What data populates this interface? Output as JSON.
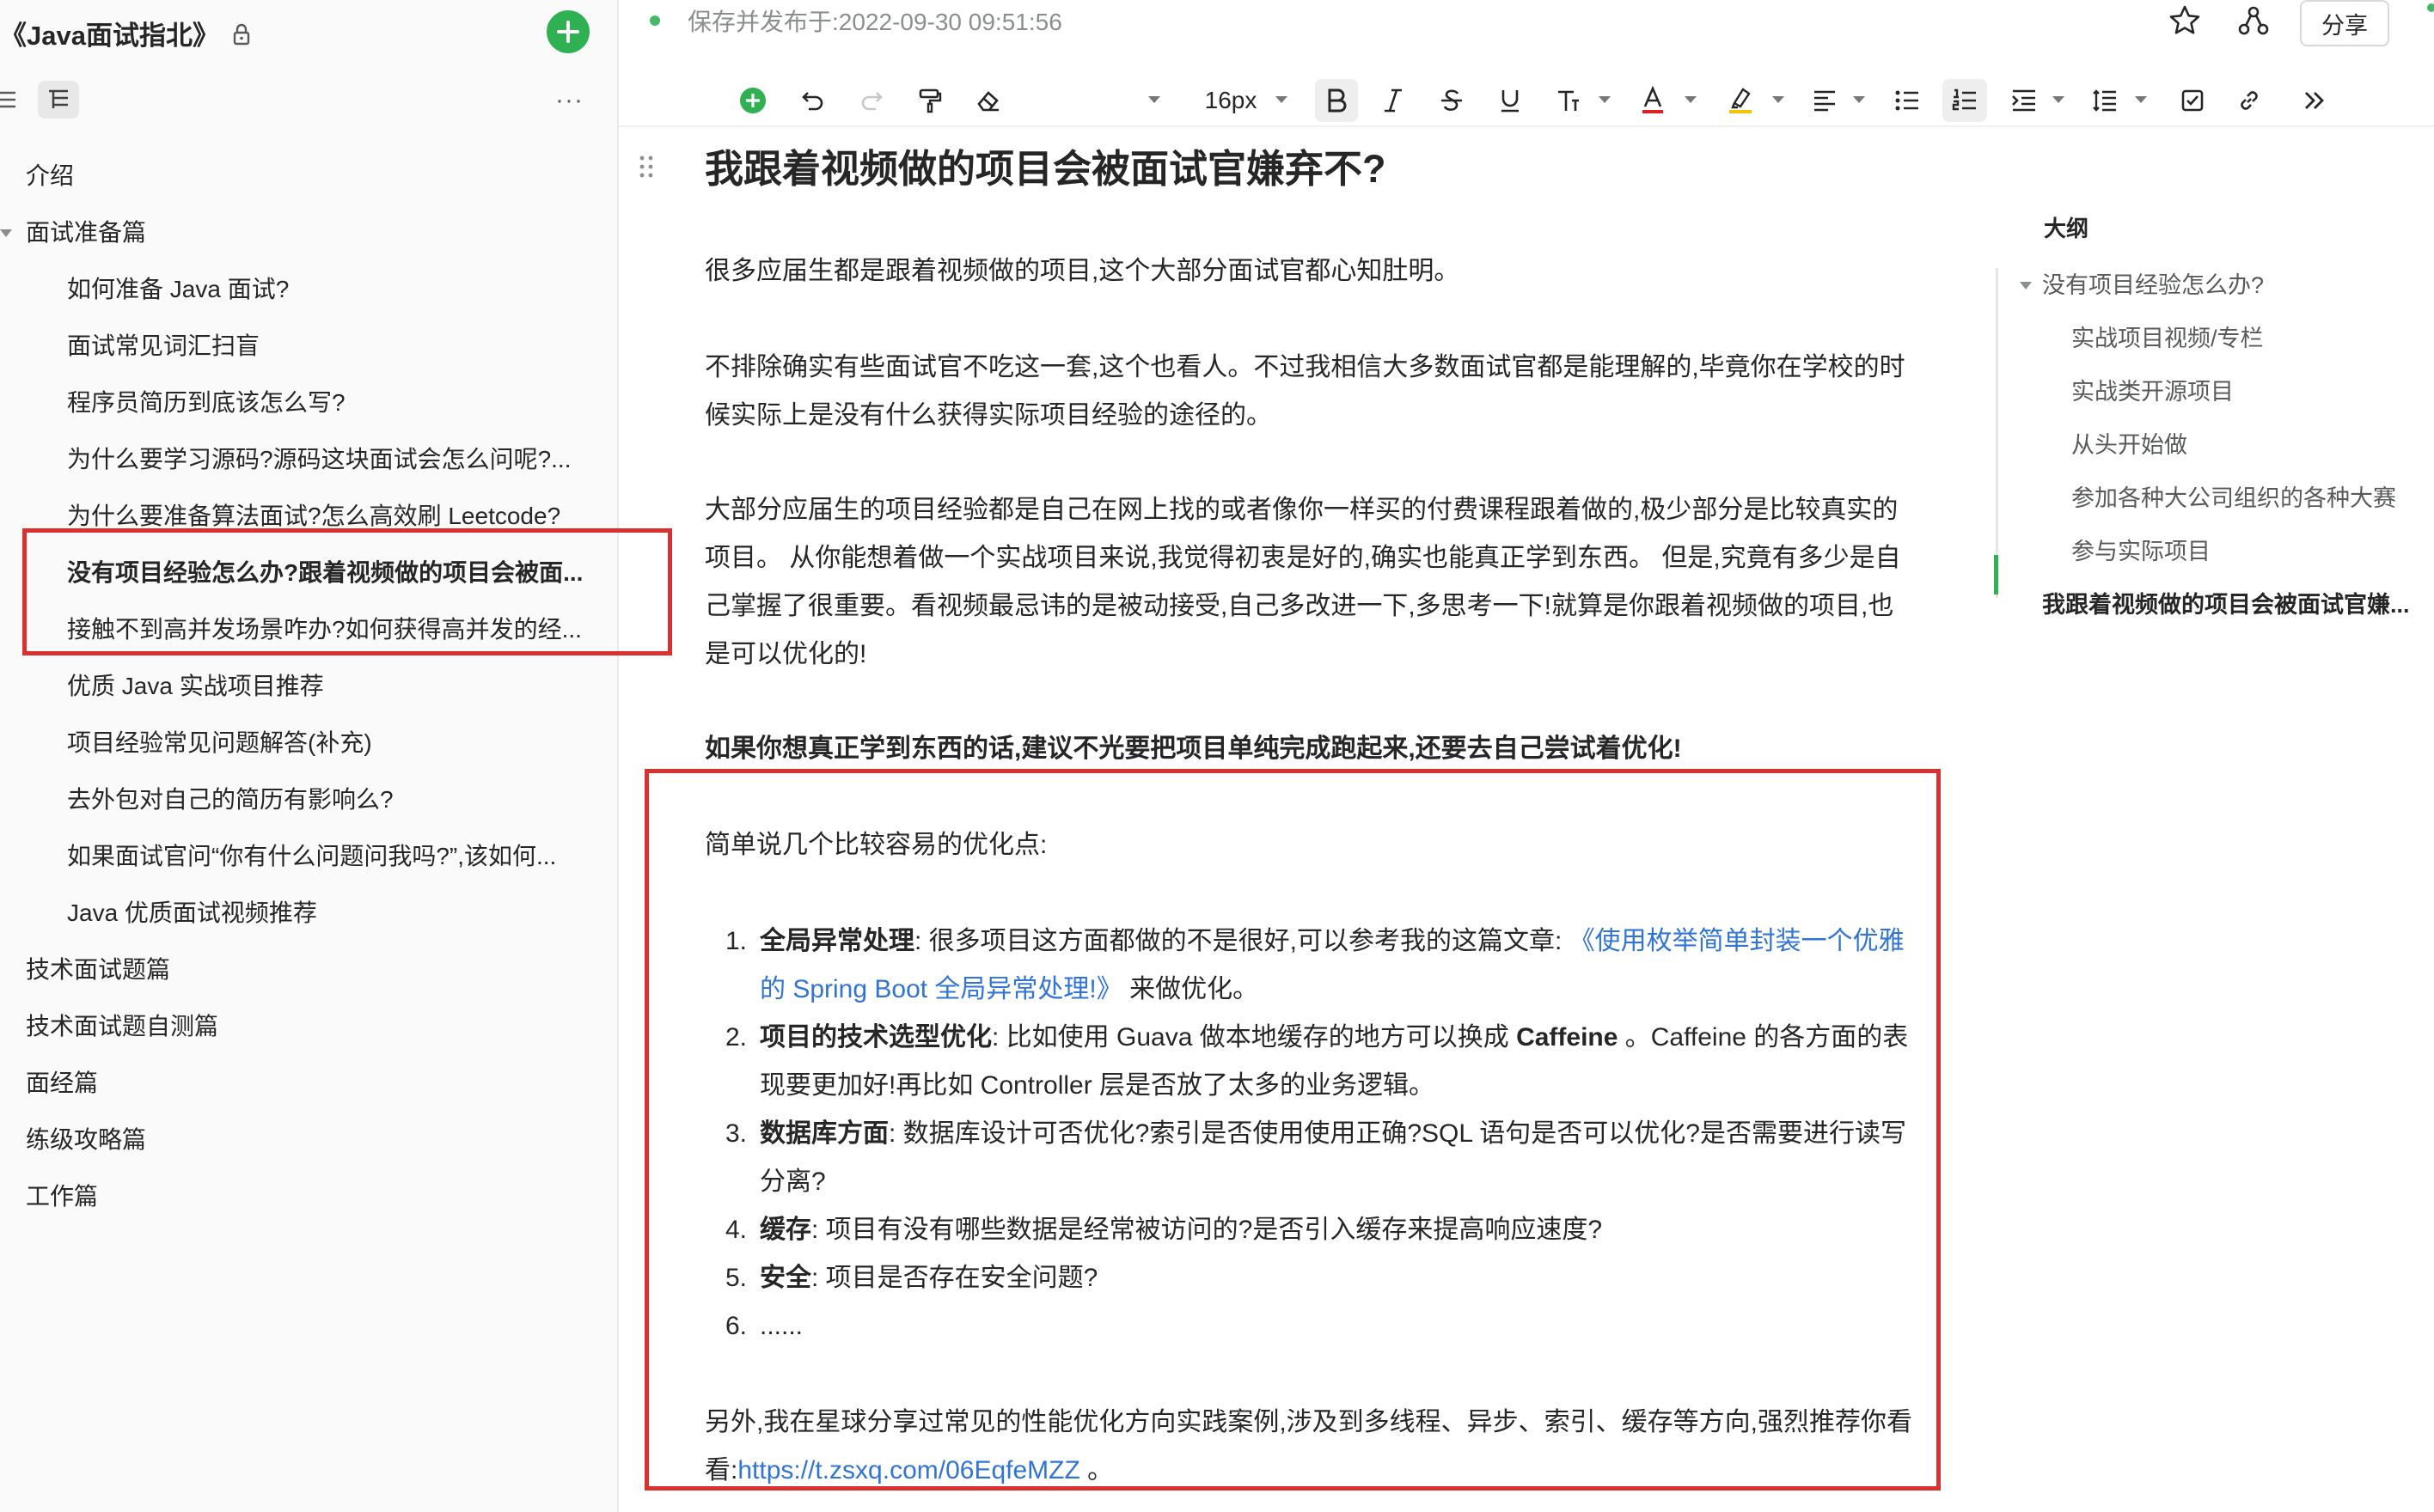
{
  "sidebar": {
    "book_title": "《Java面试指北》",
    "toc": [
      {
        "label": "介绍",
        "level": 1
      },
      {
        "label": "面试准备篇",
        "level": 1,
        "expanded": true
      },
      {
        "label": "如何准备 Java 面试?",
        "level": 2
      },
      {
        "label": "面试常见词汇扫盲",
        "level": 2
      },
      {
        "label": "程序员简历到底该怎么写?",
        "level": 2
      },
      {
        "label": "为什么要学习源码?源码这块面试会怎么问呢?...",
        "level": 2
      },
      {
        "label": "为什么要准备算法面试?怎么高效刷 Leetcode?",
        "level": 2
      },
      {
        "label": "没有项目经验怎么办?跟着视频做的项目会被面...",
        "level": 2,
        "active": true
      },
      {
        "label": "接触不到高并发场景咋办?如何获得高并发的经...",
        "level": 2
      },
      {
        "label": "优质 Java 实战项目推荐",
        "level": 2
      },
      {
        "label": "项目经验常见问题解答(补充)",
        "level": 2
      },
      {
        "label": "去外包对自己的简历有影响么?",
        "level": 2
      },
      {
        "label": "如果面试官问“你有什么问题问我吗?”,该如何...",
        "level": 2
      },
      {
        "label": "Java 优质面试视频推荐",
        "level": 2
      },
      {
        "label": "技术面试题篇",
        "level": 1
      },
      {
        "label": "技术面试题自测篇",
        "level": 1
      },
      {
        "label": "面经篇",
        "level": 1
      },
      {
        "label": "练级攻略篇",
        "level": 1
      },
      {
        "label": "工作篇",
        "level": 1
      }
    ]
  },
  "topbar": {
    "status": "保存并发布于:2022-09-30 09:51:56",
    "share_label": "分享"
  },
  "toolbar": {
    "font_size": "16px"
  },
  "document": {
    "title": "我跟着视频做的项目会被面试官嫌弃不?",
    "p1": "很多应届生都是跟着视频做的项目,这个大部分面试官都心知肚明。",
    "p2": "不排除确实有些面试官不吃这一套,这个也看人。不过我相信大多数面试官都是能理解的,毕竟你在学校的时候实际上是没有什么获得实际项目经验的途径的。",
    "p3": "大部分应届生的项目经验都是自己在网上找的或者像你一样买的付费课程跟着做的,极少部分是比较真实的项目。 从你能想着做一个实战项目来说,我觉得初衷是好的,确实也能真正学到东西。 但是,究竟有多少是自己掌握了很重要。看视频最忌讳的是被动接受,自己多改进一下,多思考一下!就算是你跟着视频做的项目,也是可以优化的!",
    "p4_bold": "如果你想真正学到东西的话,建议不光要把项目单纯完成跑起来,还要去自己尝试着优化!",
    "p5": "简单说几个比较容易的优化点:",
    "list": [
      {
        "num": "1.",
        "bold": "全局异常处理",
        "text": ": 很多项目这方面都做的不是很好,可以参考我的这篇文章: ",
        "link": "《使用枚举简单封装一个优雅的 Spring Boot 全局异常处理!》",
        "tail": " 来做优化。"
      },
      {
        "num": "2.",
        "bold": "项目的技术选型优化",
        "text": ": 比如使用 Guava 做本地缓存的地方可以换成 ",
        "bold2": "Caffeine",
        "tail": " 。Caffeine 的各方面的表现要更加好!再比如 Controller 层是否放了太多的业务逻辑。"
      },
      {
        "num": "3.",
        "bold": "数据库方面",
        "text": ": 数据库设计可否优化?索引是否使用使用正确?SQL 语句是否可以优化?是否需要进行读写分离?"
      },
      {
        "num": "4.",
        "bold": "缓存",
        "text": ": 项目有没有哪些数据是经常被访问的?是否引入缓存来提高响应速度?"
      },
      {
        "num": "5.",
        "bold": "安全",
        "text": ": 项目是否存在安全问题?"
      },
      {
        "num": "6.",
        "bold": "",
        "text": "......"
      }
    ],
    "p6": "另外,我在星球分享过常见的性能优化方向实践案例,涉及到多线程、异步、索引、缓存等方向,强烈推荐你看看:",
    "p6_link": "https://t.zsxq.com/06EqfeMZZ",
    "p6_tail": " 。"
  },
  "outline": {
    "title": "大纲",
    "items": [
      {
        "label": "没有项目经验怎么办?",
        "level": 1
      },
      {
        "label": "实战项目视频/专栏",
        "level": 2
      },
      {
        "label": "实战类开源项目",
        "level": 2
      },
      {
        "label": "从头开始做",
        "level": 2
      },
      {
        "label": "参加各种大公司组织的各种大赛",
        "level": 2
      },
      {
        "label": "参与实际项目",
        "level": 2
      },
      {
        "label": "我跟着视频做的项目会被面试官嫌...",
        "level": 1,
        "active": true
      }
    ]
  },
  "colors": {
    "accent_green": "#2fb053",
    "highlight_red": "#d93030",
    "link_blue": "#2f74d6"
  }
}
